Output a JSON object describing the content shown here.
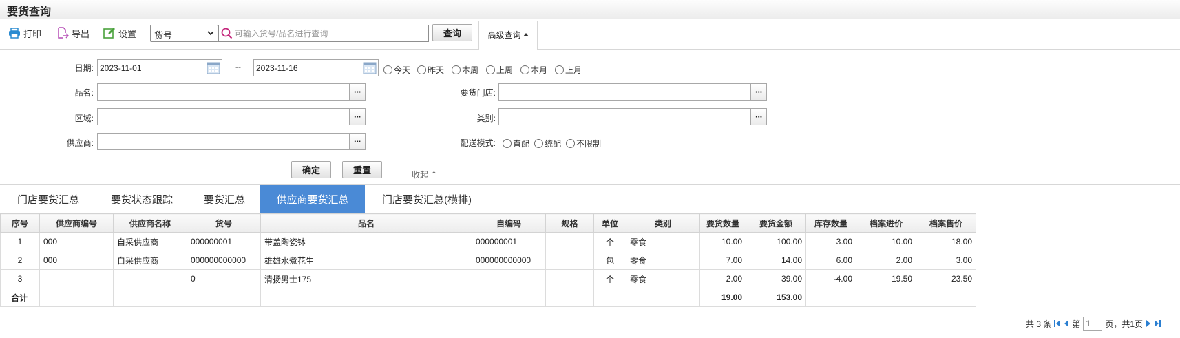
{
  "page": {
    "title": "要货查询"
  },
  "toolbar": {
    "print_label": "打印",
    "export_label": "导出",
    "settings_label": "设置",
    "field_select": "货号",
    "search_placeholder": "可输入货号/品名进行查询",
    "query_label": "查询",
    "advanced_label": "高级查询"
  },
  "filters": {
    "date_label": "日期:",
    "date_from": "2023-11-01",
    "date_sep": "--",
    "date_to": "2023-11-16",
    "date_presets": [
      "今天",
      "昨天",
      "本周",
      "上周",
      "本月",
      "上月"
    ],
    "product_label": "品名:",
    "store_label": "要货门店:",
    "region_label": "区域:",
    "category_label": "类别:",
    "supplier_label": "供应商:",
    "delivery_label": "配送模式:",
    "delivery_options": [
      "直配",
      "统配",
      "不限制"
    ],
    "confirm_label": "确定",
    "reset_label": "重置",
    "collapse_label": "收起 ⌃"
  },
  "tabs": [
    "门店要货汇总",
    "要货状态跟踪",
    "要货汇总",
    "供应商要货汇总",
    "门店要货汇总(横排)"
  ],
  "active_tab": 3,
  "table": {
    "headers": [
      "序号",
      "供应商编号",
      "供应商名称",
      "货号",
      "品名",
      "自编码",
      "规格",
      "单位",
      "类别",
      "要货数量",
      "要货金额",
      "库存数量",
      "档案进价",
      "档案售价"
    ],
    "rows": [
      [
        "1",
        "000",
        "自采供应商",
        "000000001",
        "带盖陶瓷钵",
        "000000001",
        "",
        "个",
        "零食",
        "10.00",
        "100.00",
        "3.00",
        "10.00",
        "18.00"
      ],
      [
        "2",
        "000",
        "自采供应商",
        "000000000000",
        "雄雄水煮花生",
        "000000000000",
        "",
        "包",
        "零食",
        "7.00",
        "14.00",
        "6.00",
        "2.00",
        "3.00"
      ],
      [
        "3",
        "",
        "",
        "0",
        "清扬男士175",
        "",
        "",
        "个",
        "零食",
        "2.00",
        "39.00",
        "-4.00",
        "19.50",
        "23.50"
      ]
    ],
    "total_row": [
      "合计",
      "",
      "",
      "",
      "",
      "",
      "",
      "",
      "",
      "19.00",
      "153.00",
      "",
      "",
      ""
    ]
  },
  "pager": {
    "total_text": "共 3 条",
    "page_prefix": "第",
    "page_value": "1",
    "page_suffix": "页，共1页"
  }
}
